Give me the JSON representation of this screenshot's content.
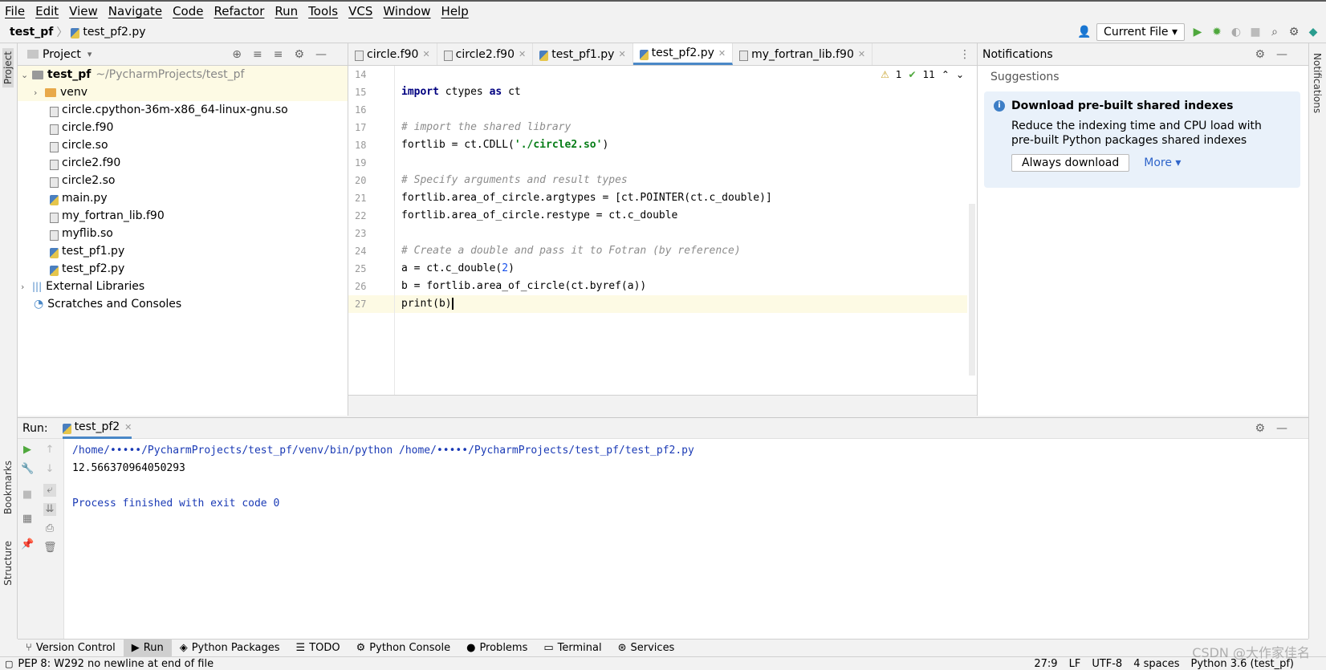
{
  "menu": [
    "File",
    "Edit",
    "View",
    "Navigate",
    "Code",
    "Refactor",
    "Run",
    "Tools",
    "VCS",
    "Window",
    "Help"
  ],
  "breadcrumb": {
    "project": "test_pf",
    "file": "test_pf2.py"
  },
  "toolbar": {
    "run_config": "Current File"
  },
  "sidebar_left": {
    "project_label": "Project",
    "bookmarks_label": "Bookmarks",
    "structure_label": "Structure"
  },
  "sidebar_right": {
    "notifications_label": "Notifications"
  },
  "project_panel": {
    "title": "Project",
    "root": {
      "name": "test_pf",
      "path": "~/PycharmProjects/test_pf"
    },
    "items": [
      {
        "name": "venv",
        "type": "folder"
      },
      {
        "name": "circle.cpython-36m-x86_64-linux-gnu.so",
        "type": "so"
      },
      {
        "name": "circle.f90",
        "type": "f90"
      },
      {
        "name": "circle.so",
        "type": "so"
      },
      {
        "name": "circle2.f90",
        "type": "f90"
      },
      {
        "name": "circle2.so",
        "type": "so"
      },
      {
        "name": "main.py",
        "type": "py"
      },
      {
        "name": "my_fortran_lib.f90",
        "type": "f90"
      },
      {
        "name": "myflib.so",
        "type": "so"
      },
      {
        "name": "test_pf1.py",
        "type": "py"
      },
      {
        "name": "test_pf2.py",
        "type": "py"
      }
    ],
    "external": "External Libraries",
    "scratches": "Scratches and Consoles"
  },
  "editor": {
    "tabs": [
      "circle.f90",
      "circle2.f90",
      "test_pf1.py",
      "test_pf2.py",
      "my_fortran_lib.f90"
    ],
    "active_tab": "test_pf2.py",
    "inspections": {
      "warnings": "1",
      "ok": "11"
    },
    "line_numbers": [
      "14",
      "15",
      "16",
      "17",
      "18",
      "19",
      "20",
      "21",
      "22",
      "23",
      "24",
      "25",
      "26",
      "27"
    ],
    "lines": {
      "l15_kw": "import",
      "l15_rest": " ctypes ",
      "l15_as": "as",
      "l15_end": " ct",
      "l17": "# import the shared library",
      "l18_a": "fortlib = ct.CDLL(",
      "l18_s": "'./circle2.so'",
      "l18_b": ")",
      "l20": "# Specify arguments and result types",
      "l21": "fortlib.area_of_circle.argtypes = [ct.POINTER(ct.c_double)]",
      "l22": "fortlib.area_of_circle.restype = ct.c_double",
      "l24": "# Create a double and pass it to Fotran (by reference)",
      "l25_a": "a = ct.c_double(",
      "l25_n": "2",
      "l25_b": ")",
      "l26": "b = fortlib.area_of_circle(ct.byref(a))",
      "l27": "print(b)"
    }
  },
  "notifications": {
    "title": "Notifications",
    "section": "Suggestions",
    "heading": "Download pre-built shared indexes",
    "body1": "Reduce the indexing time and CPU load with",
    "body2": "pre-built Python packages shared indexes",
    "primary_button": "Always download",
    "more_link": "More"
  },
  "run_panel": {
    "label": "Run:",
    "tab": "test_pf2",
    "output": [
      "/home/•••••/PycharmProjects/test_pf/venv/bin/python /home/•••••/PycharmProjects/test_pf/test_pf2.py",
      "12.566370964050293",
      "",
      "Process finished with exit code 0"
    ]
  },
  "bottom_tabs": [
    "Version Control",
    "Run",
    "Python Packages",
    "TODO",
    "Python Console",
    "Problems",
    "Terminal",
    "Services"
  ],
  "status": {
    "message": "PEP 8: W292 no newline at end of file",
    "position": "27:9",
    "line_sep": "LF",
    "encoding": "UTF-8",
    "indent": "4 spaces",
    "interpreter": "Python 3.6 (test_pf)"
  },
  "watermark": "CSDN @大作家佳名",
  "colors": {
    "accent": "#4a88c7",
    "run_green": "#4fa83d",
    "keyword": "#000080",
    "string": "#067d17",
    "comment": "#8c8c8c"
  }
}
